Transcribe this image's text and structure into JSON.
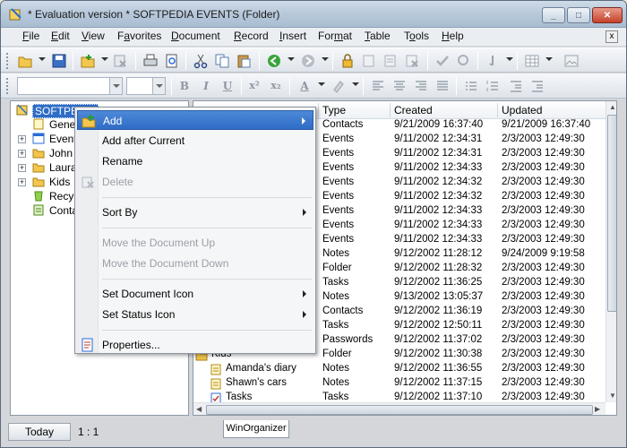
{
  "window": {
    "title": "* Evaluation version * SOFTPEDIA EVENTS (Folder)",
    "min": "_",
    "max": "□",
    "close": "✕"
  },
  "menu": [
    "File",
    "Edit",
    "View",
    "Favorites",
    "Document",
    "Record",
    "Insert",
    "Format",
    "Table",
    "Tools",
    "Help"
  ],
  "menu_underline": [
    "F",
    "E",
    "V",
    "a",
    "D",
    "R",
    "I",
    "m",
    "T",
    "o",
    "H"
  ],
  "mdi_close": "x",
  "tree": {
    "root": "SOFTPEDIA",
    "items": [
      "Gene",
      "Event",
      "John",
      "Laura",
      "Kids",
      "Recye",
      "Conta"
    ]
  },
  "list": {
    "headers": [
      "Type",
      "Created",
      "Updated"
    ],
    "rows": [
      {
        "name": "",
        "type": "Contacts",
        "created": "9/21/2009 16:37:40",
        "updated": "9/21/2009 16:37:40"
      },
      {
        "name": "",
        "type": "Events",
        "created": "9/11/2002 12:34:31",
        "updated": "2/3/2003 12:49:30"
      },
      {
        "name": "",
        "type": "Events",
        "created": "9/11/2002 12:34:31",
        "updated": "2/3/2003 12:49:30"
      },
      {
        "name": "",
        "type": "Events",
        "created": "9/11/2002 12:34:33",
        "updated": "2/3/2003 12:49:30"
      },
      {
        "name": "",
        "type": "Events",
        "created": "9/11/2002 12:34:32",
        "updated": "2/3/2003 12:49:30"
      },
      {
        "name": "",
        "type": "Events",
        "created": "9/11/2002 12:34:32",
        "updated": "2/3/2003 12:49:30"
      },
      {
        "name": "",
        "type": "Events",
        "created": "9/11/2002 12:34:33",
        "updated": "2/3/2003 12:49:30"
      },
      {
        "name": "",
        "type": "Events",
        "created": "9/11/2002 12:34:33",
        "updated": "2/3/2003 12:49:30"
      },
      {
        "name": "",
        "type": "Events",
        "created": "9/11/2002 12:34:33",
        "updated": "2/3/2003 12:49:30"
      },
      {
        "name": "",
        "type": "Notes",
        "created": "9/12/2002 11:28:12",
        "updated": "9/24/2009 9:19:58"
      },
      {
        "name": "",
        "type": "Folder",
        "created": "9/12/2002 11:28:32",
        "updated": "2/3/2003 12:49:30"
      },
      {
        "name": "",
        "type": "Tasks",
        "created": "9/12/2002 11:36:25",
        "updated": "2/3/2003 12:49:30"
      },
      {
        "name": "",
        "type": "Notes",
        "created": "9/13/2002 13:05:37",
        "updated": "2/3/2003 12:49:30"
      },
      {
        "name": "",
        "type": "Contacts",
        "created": "9/12/2002 11:36:19",
        "updated": "2/3/2003 12:49:30"
      },
      {
        "name": "",
        "type": "Tasks",
        "created": "9/12/2002 12:50:11",
        "updated": "2/3/2003 12:49:30"
      },
      {
        "name": "",
        "type": "Passwords",
        "created": "9/12/2002 11:37:02",
        "updated": "2/3/2003 12:49:30"
      },
      {
        "name": "Kids",
        "type": "Folder",
        "created": "9/12/2002 11:30:38",
        "updated": "2/3/2003 12:49:30"
      },
      {
        "name": "Amanda's diary",
        "type": "Notes",
        "created": "9/12/2002 11:36:55",
        "updated": "2/3/2003 12:49:30"
      },
      {
        "name": "Shawn's cars",
        "type": "Notes",
        "created": "9/12/2002 11:37:15",
        "updated": "2/3/2003 12:49:30"
      },
      {
        "name": "Tasks",
        "type": "Tasks",
        "created": "9/12/2002 11:37:10",
        "updated": "2/3/2003 12:49:30"
      }
    ]
  },
  "context_menu": [
    {
      "label": "Add",
      "selected": true,
      "submenu": true,
      "disabled": false,
      "icon": "add-document-icon"
    },
    {
      "label": "Add after Current",
      "disabled": false
    },
    {
      "label": "Rename",
      "disabled": false
    },
    {
      "label": "Delete",
      "disabled": true,
      "icon": "delete-icon"
    },
    {
      "sep": true
    },
    {
      "label": "Sort By",
      "submenu": true,
      "disabled": false
    },
    {
      "sep": true
    },
    {
      "label": "Move the Document Up",
      "disabled": true
    },
    {
      "label": "Move the Document Down",
      "disabled": true
    },
    {
      "sep": true
    },
    {
      "label": "Set Document Icon",
      "submenu": true,
      "disabled": false
    },
    {
      "label": "Set Status Icon",
      "submenu": true,
      "disabled": false
    },
    {
      "sep": true
    },
    {
      "label": "Properties...",
      "disabled": false,
      "icon": "properties-icon"
    }
  ],
  "status": {
    "today": "Today",
    "ratio": "1 : 1",
    "tab": "WinOrganizer"
  },
  "colors": {
    "selection": "#2e6cc6",
    "folder": "#f3c64e"
  }
}
